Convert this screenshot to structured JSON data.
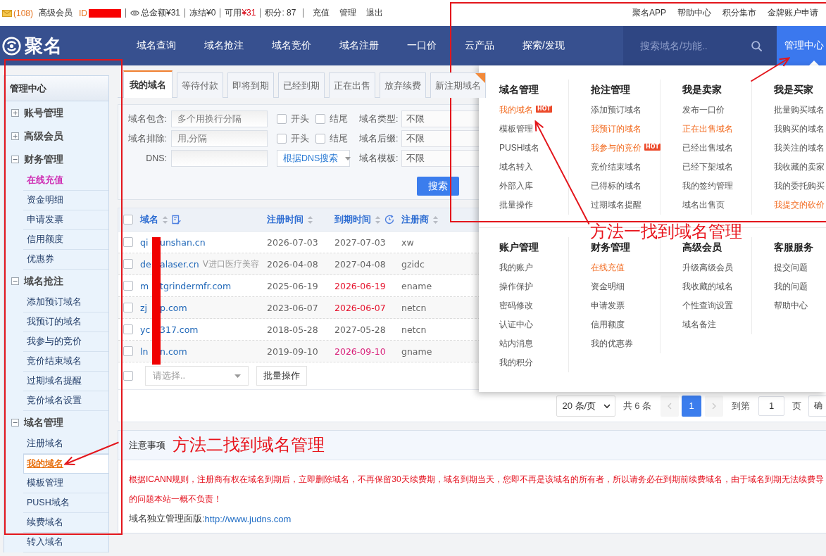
{
  "top_bar": {
    "message_count": "(108)",
    "member_level": "高级会员",
    "user_id_label": "ID",
    "total_balance": "总金额¥31",
    "frozen": "冻结¥0",
    "available": {
      "label": "可用",
      "amount": "¥31"
    },
    "points": "积分: 87",
    "actions": [
      "充值",
      "管理",
      "退出"
    ],
    "links": [
      "聚名APP",
      "帮助中心",
      "积分集市",
      "金牌账户申请"
    ]
  },
  "nav": {
    "logo": "聚名",
    "items": [
      "域名查询",
      "域名抢注",
      "域名竞价",
      "域名注册",
      "一口价",
      "云产品",
      "探索/发现"
    ],
    "search": {
      "placeholder": "搜索域名/功能.."
    },
    "manage_center": {
      "label": "管理中心",
      "expanded": true
    }
  },
  "sidebar": {
    "title": "管理中心",
    "groups": [
      {
        "label": "账号管理",
        "expanded": false
      },
      {
        "label": "高级会员",
        "expanded": false
      },
      {
        "label": "财务管理",
        "expanded": true,
        "children": [
          {
            "label": "在线充值",
            "selected": false,
            "highlighted": true
          },
          {
            "label": "资金明细",
            "selected": false,
            "highlighted": false
          },
          {
            "label": "申请发票",
            "selected": false,
            "highlighted": false
          },
          {
            "label": "信用额度",
            "selected": false,
            "highlighted": false
          },
          {
            "label": "优惠券",
            "selected": false,
            "highlighted": false
          }
        ]
      },
      {
        "label": "域名抢注",
        "expanded": true,
        "children": [
          {
            "label": "添加预订域名",
            "selected": false,
            "highlighted": false
          },
          {
            "label": "我预订的域名",
            "selected": false,
            "highlighted": false
          },
          {
            "label": "我参与的竞价",
            "selected": false,
            "highlighted": false
          },
          {
            "label": "竞价结束域名",
            "selected": false,
            "highlighted": false
          },
          {
            "label": "过期域名提醒",
            "selected": false,
            "highlighted": false
          },
          {
            "label": "竞价域名设置",
            "selected": false,
            "highlighted": false
          }
        ]
      },
      {
        "label": "域名管理",
        "expanded": true,
        "children": [
          {
            "label": "注册域名",
            "selected": false,
            "highlighted": false
          },
          {
            "label": "我的域名",
            "selected": true,
            "highlighted": false
          },
          {
            "label": "模板管理",
            "selected": false,
            "highlighted": false
          },
          {
            "label": "PUSH域名",
            "selected": false,
            "highlighted": false
          },
          {
            "label": "续费域名",
            "selected": false,
            "highlighted": false
          },
          {
            "label": "转入域名",
            "selected": false,
            "highlighted": false
          }
        ]
      }
    ]
  },
  "tabs": [
    {
      "label": "我的域名",
      "selected": true
    },
    {
      "label": "等待付款",
      "selected": false
    },
    {
      "label": "即将到期",
      "selected": false
    },
    {
      "label": "已经到期",
      "selected": false
    },
    {
      "label": "正在出售",
      "selected": false
    },
    {
      "label": "放弃续费",
      "selected": false
    },
    {
      "label": "新注期域名",
      "selected": false,
      "ribbon": true
    }
  ],
  "filters": {
    "rows": [
      {
        "label": "域名包含:",
        "placeholder": "多个用换行分隔",
        "extra": {
          "kind": "checkboxes",
          "options": [
            {
              "label": "开头",
              "checked": false
            },
            {
              "label": "结尾",
              "checked": false
            }
          ]
        },
        "select": {
          "label": "域名类型:",
          "value": "不限"
        }
      },
      {
        "label": "域名排除:",
        "placeholder": "用,分隔",
        "extra": {
          "kind": "checkboxes",
          "options": [
            {
              "label": "开头",
              "checked": false
            },
            {
              "label": "结尾",
              "checked": false
            }
          ]
        },
        "select": {
          "label": "域名后缀:",
          "value": "不限"
        }
      },
      {
        "label": "DNS:",
        "extra": {
          "kind": "dropdown",
          "value": "根据DNS搜索"
        },
        "select": {
          "label": "域名模板:",
          "value": "不限"
        }
      }
    ],
    "search_button": "搜索"
  },
  "table": {
    "all_checked": false,
    "columns": [
      {
        "label": "域名",
        "kind": "domain"
      },
      {
        "label": "注册时间",
        "kind": "date"
      },
      {
        "label": "到期时间",
        "kind": "expiry"
      },
      {
        "label": "注册商",
        "kind": "text"
      }
    ],
    "rows": [
      {
        "checked": false,
        "domain_start": "qi",
        "domain_end": "unshan.cn",
        "registered": "2026-07-03",
        "expires": "2027-07-03",
        "color": "#666666",
        "registrar": "xw"
      },
      {
        "checked": false,
        "domain_start": "de",
        "domain_end": "alaser.cn",
        "remark": "V进口医疗美容",
        "registered": "2026-04-08",
        "expires": "2027-04-08",
        "color": "#666666",
        "registrar": "gzidc"
      },
      {
        "checked": false,
        "domain_start": "m",
        "domain_end": "tgrindermfr.com",
        "registered": "2025-06-19",
        "expires": "2026-06-19",
        "color": "#e5132d",
        "registrar": "ename"
      },
      {
        "checked": false,
        "domain_start": "zj",
        "domain_end": "p.com",
        "registered": "2023-06-07",
        "expires": "2026-06-07",
        "color": "#e5132d",
        "registrar": "netcn"
      },
      {
        "checked": false,
        "domain_start": "yc",
        "domain_end": "317.com",
        "registered": "2018-05-28",
        "expires": "2027-05-28",
        "color": "#666666",
        "registrar": "netcn"
      },
      {
        "checked": false,
        "domain_start": "ln",
        "domain_end": "n.com",
        "registered": "2019-09-10",
        "expires": "2026-09-10",
        "color": "#d81e78",
        "registrar": "gname"
      }
    ]
  },
  "batch": {
    "checked": false,
    "placeholder": "请选择..",
    "button": "批量操作"
  },
  "pagination": {
    "page_size": "20 条/页",
    "total": "共 6 条",
    "prev_disabled": true,
    "pages": [
      {
        "label": "1",
        "selected": true
      }
    ],
    "next_disabled": true,
    "goto_label": "到第",
    "goto_value": "1",
    "page_unit": "页",
    "confirm": "确"
  },
  "notice": {
    "title": "注意事项",
    "lines": [
      {
        "kind": "warning",
        "text": "根据ICANN规则，注册商有权在域名到期后，立即删除域名，不再保留30天续费期，域名到期当天，您即不再是该域名的所有者，所以请务必在到期前续费域名，由于域名到期无法续费导"
      },
      {
        "kind": "warning",
        "text": "的问题本站一概不负责！"
      },
      {
        "kind": "link",
        "label": "域名独立管理面版:",
        "url": "http://www.judns.com"
      }
    ]
  },
  "menu": {
    "sections": [
      {
        "columns": [
          {
            "title": "域名管理",
            "items": [
              {
                "label": "我的域名",
                "highlighted": true,
                "badge": "HOT"
              },
              {
                "label": "模板管理",
                "highlighted": false
              },
              {
                "label": "PUSH域名",
                "highlighted": false
              },
              {
                "label": "域名转入",
                "highlighted": false
              },
              {
                "label": "外部入库",
                "highlighted": false
              },
              {
                "label": "批量操作",
                "highlighted": false
              }
            ]
          },
          {
            "title": "抢注管理",
            "items": [
              {
                "label": "添加预订域名",
                "highlighted": false
              },
              {
                "label": "我预订的域名",
                "highlighted": true
              },
              {
                "label": "我参与的竞价",
                "highlighted": true,
                "badge": "HOT"
              },
              {
                "label": "竞价结束域名",
                "highlighted": false
              },
              {
                "label": "已得标的域名",
                "highlighted": false
              },
              {
                "label": "过期域名提醒",
                "highlighted": false
              }
            ]
          },
          {
            "title": "我是卖家",
            "items": [
              {
                "label": "发布一口价",
                "highlighted": false
              },
              {
                "label": "正在出售域名",
                "highlighted": true
              },
              {
                "label": "已经出售域名",
                "highlighted": false
              },
              {
                "label": "已经下架域名",
                "highlighted": false
              },
              {
                "label": "我的签约管理",
                "highlighted": false
              },
              {
                "label": "域名出售页",
                "highlighted": false
              }
            ]
          },
          {
            "title": "我是买家",
            "items": [
              {
                "label": "批量购买域名",
                "highlighted": false
              },
              {
                "label": "我购买的域名",
                "highlighted": false
              },
              {
                "label": "我关注的域名",
                "highlighted": false
              },
              {
                "label": "我收藏的卖家",
                "highlighted": false
              },
              {
                "label": "我的委托购买",
                "highlighted": false
              },
              {
                "label": "我提交的砍价",
                "highlighted": true
              }
            ]
          }
        ]
      },
      {
        "columns": [
          {
            "title": "账户管理",
            "items": [
              {
                "label": "我的账户",
                "highlighted": false
              },
              {
                "label": "操作保护",
                "highlighted": false
              },
              {
                "label": "密码修改",
                "highlighted": false
              },
              {
                "label": "认证中心",
                "highlighted": false
              },
              {
                "label": "站内消息",
                "highlighted": false
              },
              {
                "label": "我的积分",
                "highlighted": false
              }
            ]
          },
          {
            "title": "财务管理",
            "items": [
              {
                "label": "在线充值",
                "highlighted": true
              },
              {
                "label": "资金明细",
                "highlighted": false
              },
              {
                "label": "申请发票",
                "highlighted": false
              },
              {
                "label": "信用额度",
                "highlighted": false
              },
              {
                "label": "我的优惠券",
                "highlighted": false
              }
            ]
          },
          {
            "title": "高级会员",
            "items": [
              {
                "label": "升级高级会员",
                "highlighted": false
              },
              {
                "label": "我收藏的域名",
                "highlighted": false
              },
              {
                "label": "个性查询设置",
                "highlighted": false
              },
              {
                "label": "域名备注",
                "highlighted": false
              }
            ]
          },
          {
            "title": "客服服务",
            "items": [
              {
                "label": "提交问题",
                "highlighted": false
              },
              {
                "label": "我的问题",
                "highlighted": false
              },
              {
                "label": "帮助中心",
                "highlighted": false
              }
            ]
          }
        ]
      }
    ]
  },
  "annotations": [
    {
      "text": "方法一找到域名管理"
    },
    {
      "text": "方法二找到域名管理"
    }
  ]
}
